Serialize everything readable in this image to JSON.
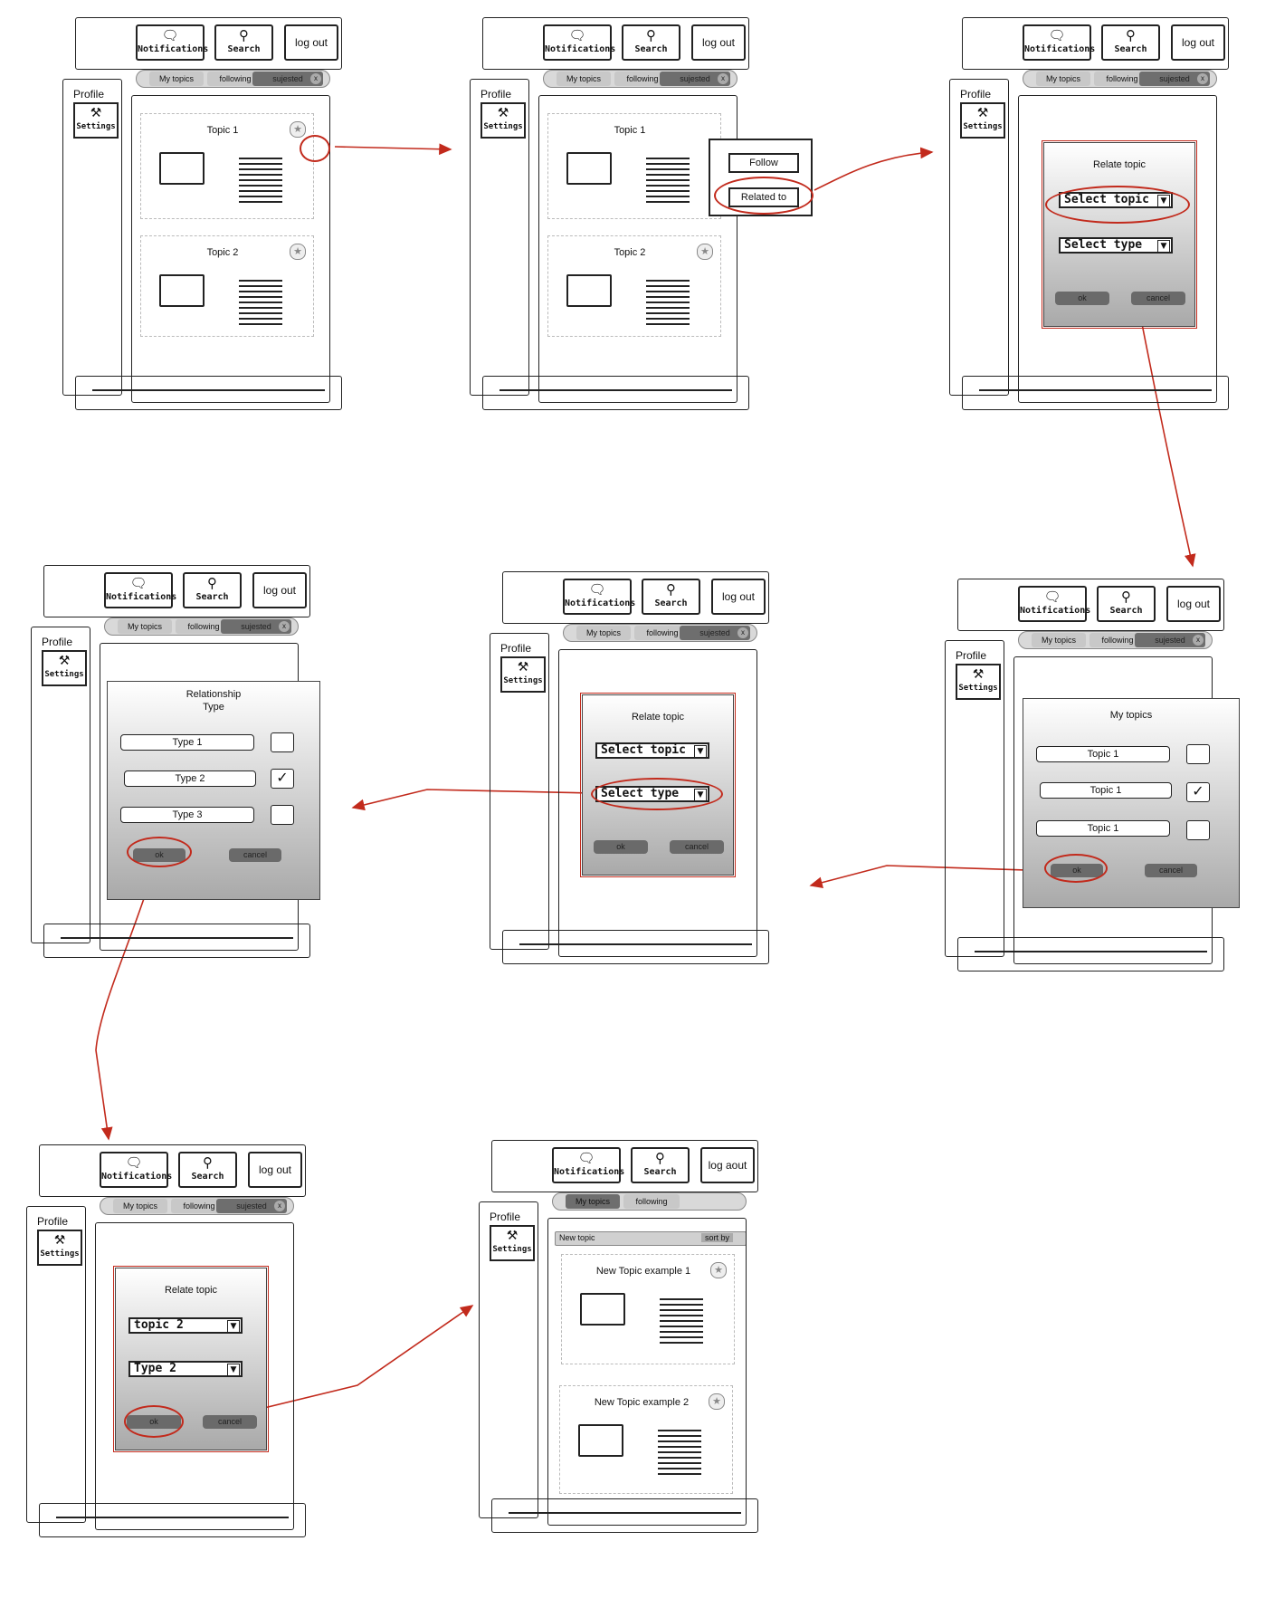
{
  "toolbar": {
    "notifications": "Notifications",
    "search": "Search",
    "logout": "log out",
    "logout_alt": "log aout"
  },
  "sidebar": {
    "profile": "Profile",
    "settings": "Settings"
  },
  "tabs": {
    "my_topics": "My topics",
    "following": "following",
    "suggested": "sujested"
  },
  "topics": {
    "topic1": "Topic 1",
    "topic2": "Topic 2"
  },
  "context_menu": {
    "follow": "Follow",
    "related_to": "Related to"
  },
  "relate_dialog": {
    "title": "Relate topic",
    "select_topic": "Select  topic",
    "select_type": "Select  type",
    "ok": "ok",
    "cancel": "cancel"
  },
  "my_topics_dialog": {
    "title": "My topics",
    "items": [
      "Topic 1",
      "Topic 1",
      "Topic 1"
    ],
    "ok": "ok",
    "cancel": "cancel"
  },
  "relationship_dialog": {
    "title_line1": "Relationship",
    "title_line2": "Type",
    "items": [
      "Type 1",
      "Type 2",
      "Type  3"
    ],
    "ok": "ok",
    "cancel": "cancel"
  },
  "filled_dialog": {
    "title": "Relate topic",
    "topic": "topic  2",
    "type": "Type   2",
    "ok": "ok",
    "cancel": "cancel"
  },
  "final_screen": {
    "new_topic": "New topic",
    "sort_by": "sort by",
    "example1": "New Topic example 1",
    "example2": "New Topic example 2"
  },
  "colors": {
    "annotation": "#c22a1c",
    "selected_tab": "#6e6e6e"
  }
}
